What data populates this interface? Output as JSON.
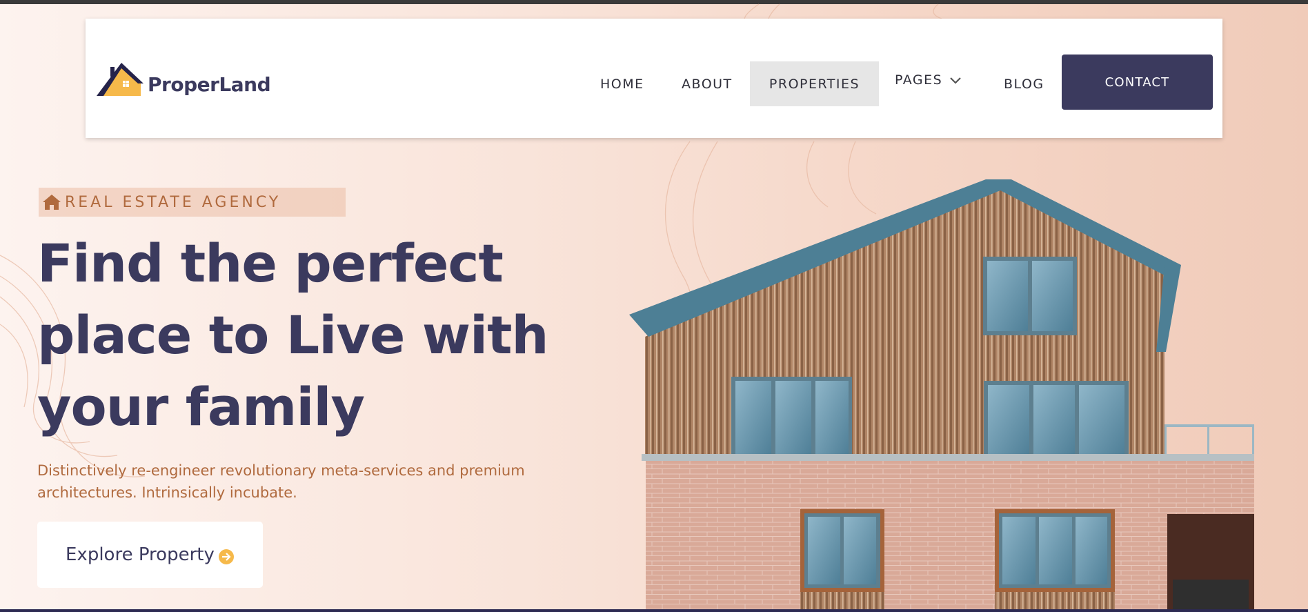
{
  "brand": {
    "name": "ProperLand",
    "logo_icon": "house-logo-icon",
    "accent": "#f6b94a",
    "primary": "#3b3a5e"
  },
  "nav": {
    "items": [
      {
        "label": "HOME"
      },
      {
        "label": "ABOUT"
      },
      {
        "label": "PROPERTIES",
        "active": true
      },
      {
        "label": "PAGES",
        "icon": "chevron-down-icon"
      },
      {
        "label": "BLOG"
      }
    ],
    "contact_label": "CONTACT"
  },
  "hero": {
    "tagline": "REAL ESTATE AGENCY",
    "tagline_icon": "home-icon",
    "title_lines": [
      "Find the perfect",
      "place to Live with",
      "your family"
    ],
    "description": "Distinctively re-engineer revolutionary meta-services and premium architectures. Intrinsically incubate.",
    "cta_label": "Explore Property",
    "cta_icon": "arrow-right-circle-icon",
    "text_accent": "#b06a3e"
  }
}
